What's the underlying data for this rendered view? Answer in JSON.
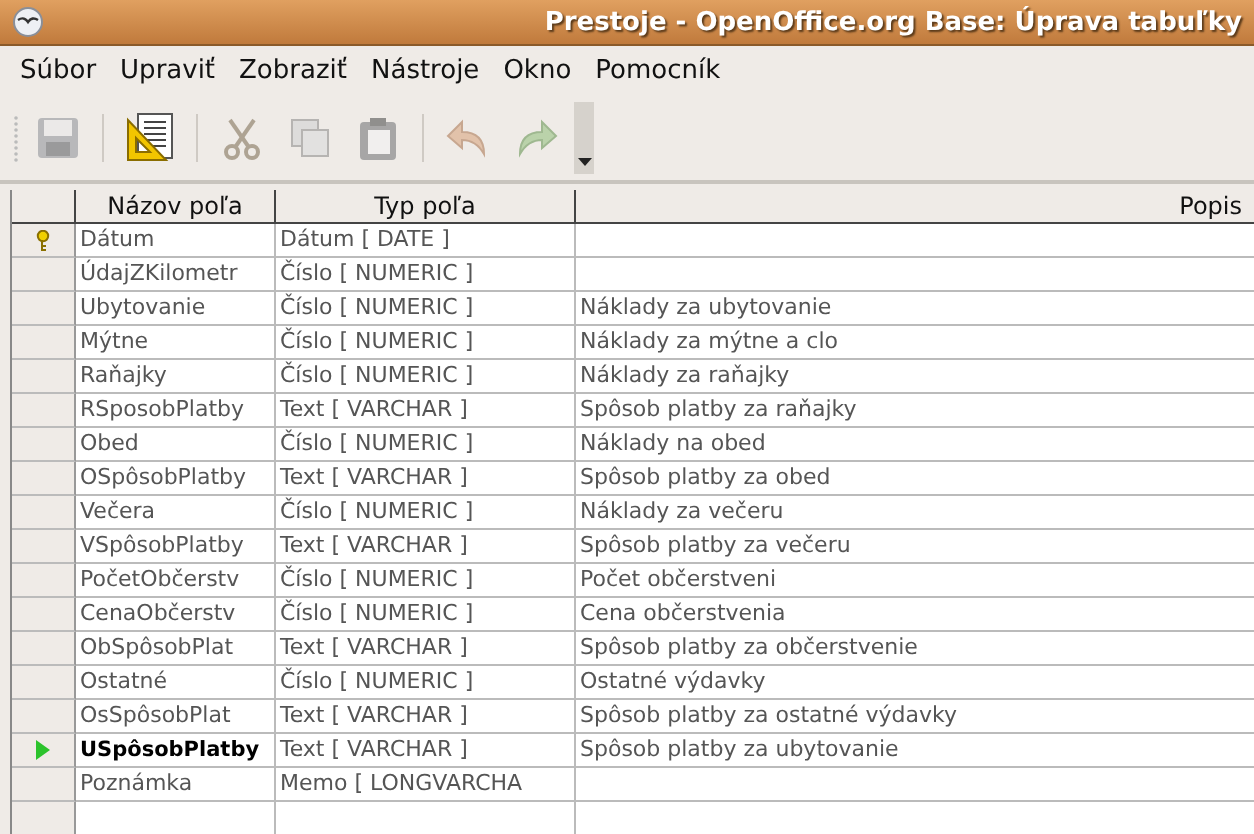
{
  "window": {
    "title": "Prestoje - OpenOffice.org Base: Úprava tabuľky"
  },
  "menu": [
    "Súbor",
    "Upraviť",
    "Zobraziť",
    "Nástroje",
    "Okno",
    "Pomocník"
  ],
  "toolbar": [
    {
      "kind": "save",
      "disabled": true
    },
    {
      "kind": "separator"
    },
    {
      "kind": "design",
      "disabled": false
    },
    {
      "kind": "separator"
    },
    {
      "kind": "cut",
      "disabled": true
    },
    {
      "kind": "copy",
      "disabled": true
    },
    {
      "kind": "paste",
      "disabled": true
    },
    {
      "kind": "separator"
    },
    {
      "kind": "undo",
      "disabled": true
    },
    {
      "kind": "redo",
      "disabled": true
    }
  ],
  "table": {
    "columns": [
      "Názov poľa",
      "Typ poľa",
      "Popis"
    ],
    "rows": [
      {
        "primary_key": true,
        "current": false,
        "name": "Dátum",
        "type": "Dátum [ DATE ]",
        "description": ""
      },
      {
        "primary_key": false,
        "current": false,
        "name": "ÚdajZKilometr",
        "type": "Číslo [ NUMERIC ]",
        "description": ""
      },
      {
        "primary_key": false,
        "current": false,
        "name": "Ubytovanie",
        "type": "Číslo [ NUMERIC ]",
        "description": "Náklady za ubytovanie"
      },
      {
        "primary_key": false,
        "current": false,
        "name": "Mýtne",
        "type": "Číslo [ NUMERIC ]",
        "description": "Náklady za mýtne a clo"
      },
      {
        "primary_key": false,
        "current": false,
        "name": "Raňajky",
        "type": "Číslo [ NUMERIC ]",
        "description": "Náklady za raňajky"
      },
      {
        "primary_key": false,
        "current": false,
        "name": "RSposobPlatby",
        "type": "Text [ VARCHAR ]",
        "description": "Spôsob platby za raňajky"
      },
      {
        "primary_key": false,
        "current": false,
        "name": "Obed",
        "type": "Číslo [ NUMERIC ]",
        "description": "Náklady na obed"
      },
      {
        "primary_key": false,
        "current": false,
        "name": "OSpôsobPlatby",
        "type": "Text [ VARCHAR ]",
        "description": "Spôsob platby za obed"
      },
      {
        "primary_key": false,
        "current": false,
        "name": "Večera",
        "type": "Číslo [ NUMERIC ]",
        "description": "Náklady za večeru"
      },
      {
        "primary_key": false,
        "current": false,
        "name": "VSpôsobPlatby",
        "type": "Text [ VARCHAR ]",
        "description": "Spôsob platby za večeru"
      },
      {
        "primary_key": false,
        "current": false,
        "name": "PočetObčerstv",
        "type": "Číslo [ NUMERIC ]",
        "description": "Počet občerstveni"
      },
      {
        "primary_key": false,
        "current": false,
        "name": "CenaObčerstv",
        "type": "Číslo [ NUMERIC ]",
        "description": "Cena občerstvenia"
      },
      {
        "primary_key": false,
        "current": false,
        "name": "ObSpôsobPlat",
        "type": "Text [ VARCHAR ]",
        "description": "Spôsob platby za občerstvenie"
      },
      {
        "primary_key": false,
        "current": false,
        "name": "Ostatné",
        "type": "Číslo [ NUMERIC ]",
        "description": "Ostatné výdavky"
      },
      {
        "primary_key": false,
        "current": false,
        "name": "OsSpôsobPlat",
        "type": "Text [ VARCHAR ]",
        "description": "Spôsob platby za ostatné výdavky"
      },
      {
        "primary_key": false,
        "current": true,
        "name": "USpôsobPlatby",
        "type": "Text [ VARCHAR ]",
        "description": "Spôsob platby za ubytovanie"
      },
      {
        "primary_key": false,
        "current": false,
        "name": "Poznámka",
        "type": "Memo [ LONGVARCHA",
        "description": ""
      }
    ]
  }
}
